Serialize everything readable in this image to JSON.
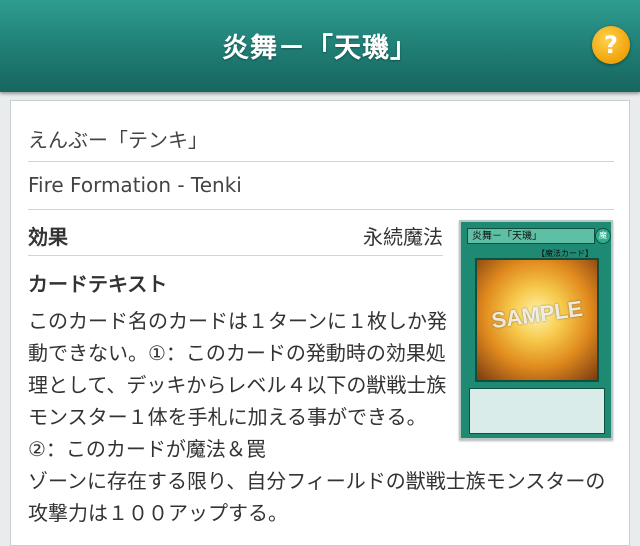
{
  "header": {
    "title": "炎舞－「天璣」",
    "help_label": "?"
  },
  "card": {
    "name_kana": "えんぶー「テンキ」",
    "name_en": "Fire Formation - Tenki",
    "effect_label": "効果",
    "effect_value": "永続魔法",
    "text_label": "カードテキスト",
    "text_part1": "このカード名のカードは１ターンに１枚しか発動できない。①：このカードの発動時の効果処理として、デッキからレベル４以下の獣戦士族モンスター１体を手札に加える事ができる。②：このカードが魔法＆罠",
    "text_part2": "ゾーンに存在する限り、自分フィールドの獣戦士族モンスターの攻撃力は１００アップする。"
  },
  "card_image": {
    "name": "炎舞－「天璣」",
    "attr": "魔",
    "type": "【魔法カード】",
    "watermark": "SAMPLE"
  }
}
